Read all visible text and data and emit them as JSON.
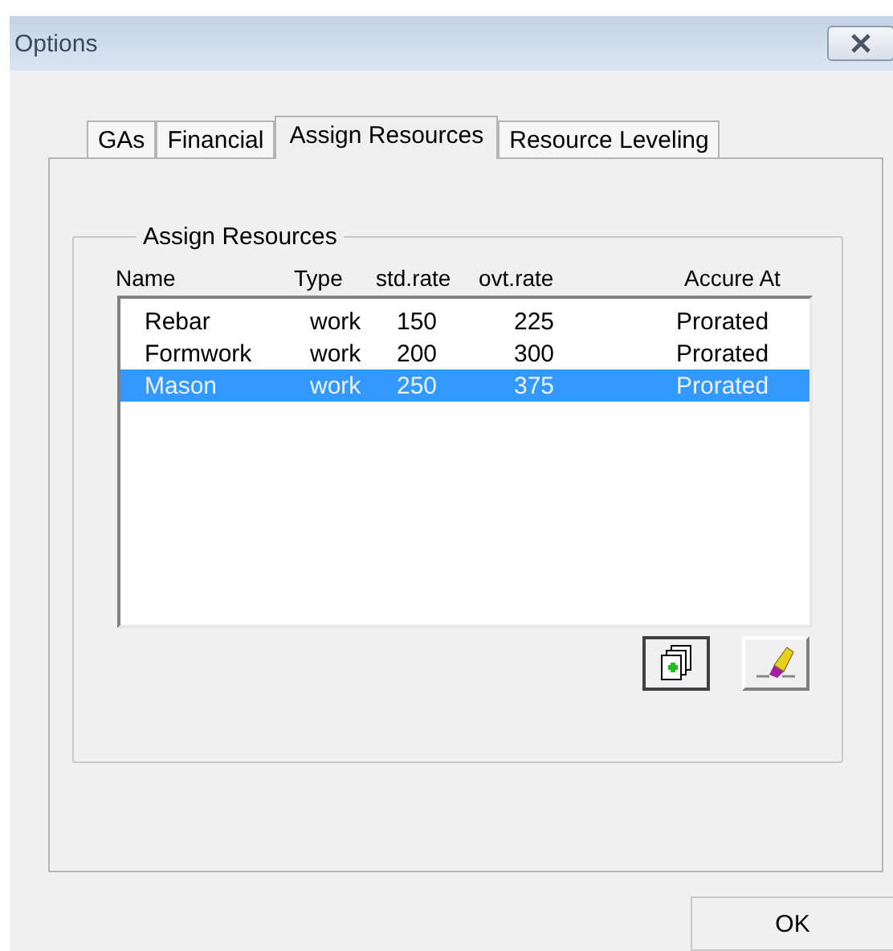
{
  "window": {
    "title": "Options"
  },
  "tabs": [
    {
      "label": "GAs",
      "selected": false
    },
    {
      "label": "Financial",
      "selected": false
    },
    {
      "label": "Assign Resources",
      "selected": true
    },
    {
      "label": "Resource Leveling",
      "selected": false
    }
  ],
  "group": {
    "title": "Assign Resources",
    "columns": [
      "Name",
      "Type",
      "std.rate",
      "ovt.rate",
      "Accure At"
    ],
    "rows": [
      {
        "cells": [
          "Rebar",
          "work",
          "150",
          "225",
          "Prorated"
        ],
        "selected": false
      },
      {
        "cells": [
          "Formwork",
          "work",
          "200",
          "300",
          "Prorated"
        ],
        "selected": false
      },
      {
        "cells": [
          "Mason",
          "work",
          "250",
          "375",
          "Prorated"
        ],
        "selected": true
      }
    ]
  },
  "buttons": [
    "OK"
  ]
}
